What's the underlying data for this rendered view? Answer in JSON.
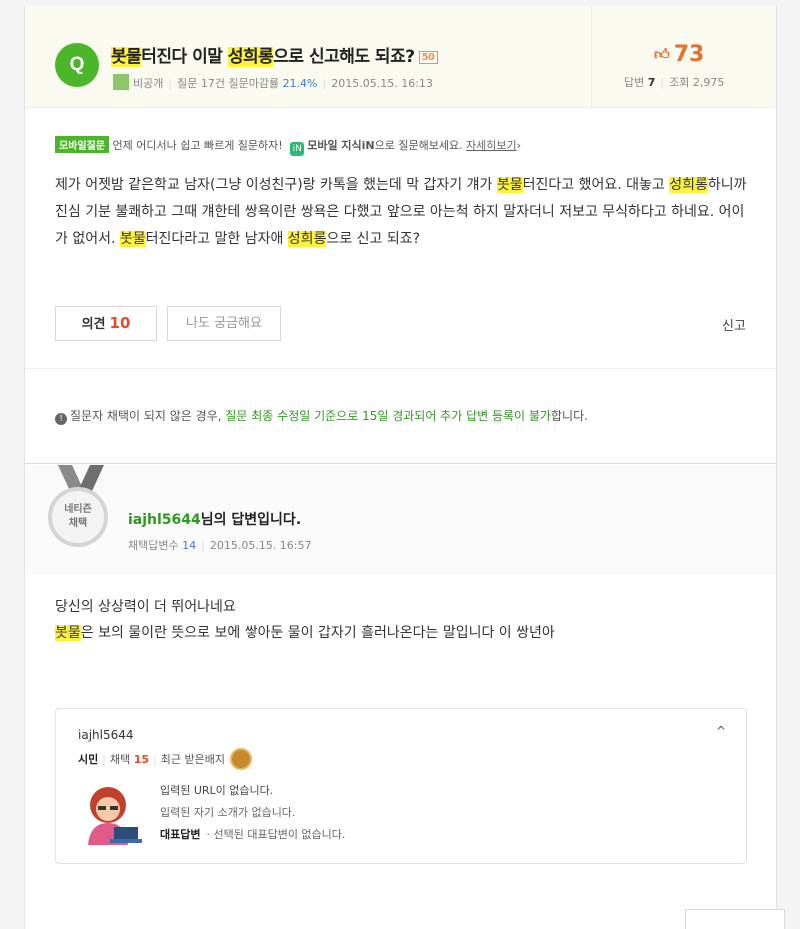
{
  "question": {
    "badge": "Q",
    "title_parts": [
      "봇물",
      "터진다 이말 ",
      "성희롱",
      "으로 신고해도 되죠?"
    ],
    "points": "50",
    "author": "비공개",
    "question_stats": "질문 17건",
    "closing_rate_label": "질문마감률",
    "closing_rate": "21.4%",
    "date": "2015.05.15. 16:13",
    "likes": "73",
    "answers_label": "답변",
    "answers": "7",
    "views_label": "조회",
    "views": "2,975",
    "body_segments": [
      "제가 어젯밤 같은학교 남자(그냥 이성친구)랑 카톡을 했는데 막 갑자기 걔가 ",
      "봇물",
      "터진다고 했어요. 대놓고 ",
      "성희롱",
      "하니까 진심 기분 불쾌하고 그때 걔한테 쌍욕이란 쌍욕은 다했고 앞으로 아는척 하지 말자더니 저보고 무식하다고 하네요. 어이가 없어서. ",
      "봇물",
      "터진다라고 말한 남자애 ",
      "성희롱",
      "으로 신고 되죠?"
    ],
    "opinion_label": "의견",
    "opinion_count": "10",
    "curious_label": "나도 궁금해요",
    "report_label": "신고"
  },
  "promo": {
    "tag": "모바일질문",
    "text": "언제 어디서나 쉽고 빠르게 질문하자!",
    "app_name": "모바일 지식iN",
    "suffix": "으로 질문해보세요.",
    "link": "자세히보기",
    "arrow": "›"
  },
  "notice": {
    "icon": "!",
    "prefix": "질문자 채택이 되지 않은 경우, ",
    "green": "질문 최종 수정일 기준으로 15일 경과되어 추가 답변 등록이 불가",
    "suffix": "합니다."
  },
  "answer": {
    "medal_line1": "네티즌",
    "medal_line2": "채택",
    "user_id": "iajhl5644",
    "title_suffix": "님의 답변입니다.",
    "adopted_label": "채택답변수",
    "adopted_count": "14",
    "date": "2015.05.15. 16:57",
    "line1": "당신의 상상력이 더 뛰어나네요",
    "line2_highlight": "봇물",
    "line2_rest": "은 보의 물이란 뜻으로 보에 쌓아둔 물이 갑자기 흘러나온다는 말입니다 이 쌍년아"
  },
  "profile": {
    "user_id": "iajhl5644",
    "level": "시민",
    "adopted_label": "채택",
    "adopted_count": "15",
    "badge_label": "최근 받은배지",
    "url_text": "입력된 URL이 없습니다.",
    "intro_text": "입력된 자기 소개가 없습니다.",
    "rep_label": "대표답변",
    "rep_text": "· 선택된 대표답변이 없습니다.",
    "collapse_icon": "^"
  },
  "colors": {
    "green": "#4cb62a",
    "orange": "#e8702a",
    "highlight": "#fff23b",
    "red": "#e8492a"
  }
}
